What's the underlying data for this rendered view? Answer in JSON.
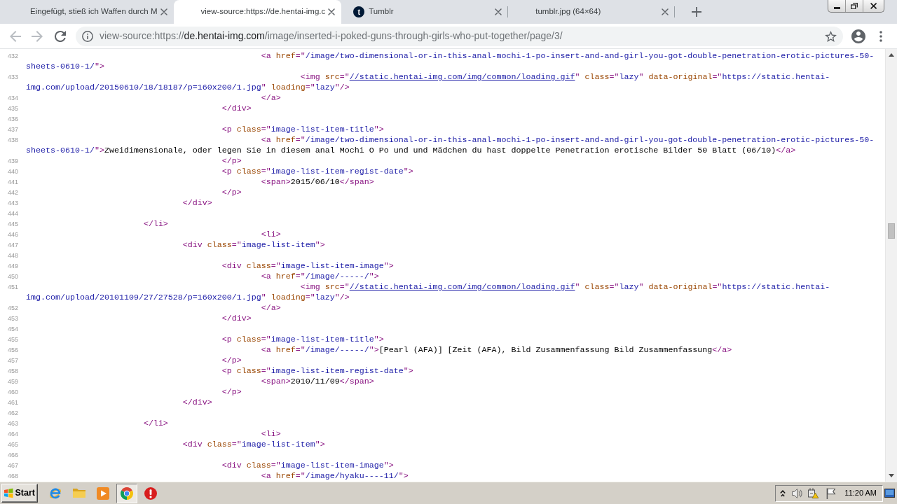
{
  "tabs": [
    {
      "title": "Eingefügt, stieß ich Waffen durch M",
      "selected": false
    },
    {
      "title": "view-source:https://de.hentai-img.c",
      "selected": true
    },
    {
      "title": "Tumblr",
      "selected": false,
      "favicon": "t"
    },
    {
      "title": "tumblr.jpg (64×64)",
      "selected": false
    }
  ],
  "toolbar": {
    "back": {
      "disabled": true
    },
    "forward": {
      "disabled": true
    },
    "address": [
      {
        "text": "view-source:https://",
        "emphasis": false
      },
      {
        "text": "de.hentai-img.com",
        "emphasis": true
      },
      {
        "text": "/image/inserted-i-poked-guns-through-girls-who-put-together/page/3/",
        "emphasis": false
      }
    ]
  },
  "source": {
    "lines": [
      {
        "number": "432",
        "tokens": [
          {
            "kind": "tag",
            "text": "\t\t\t\t\t\t<a "
          },
          {
            "kind": "attr",
            "text": "href"
          },
          {
            "kind": "tag",
            "text": "=\""
          },
          {
            "kind": "value",
            "text": "/image/two-dimensional-or-in-this-anal-mochi-1-po-insert-and-and-girl-you-got-double-penetration-erotic-pictures-50-sheets-0610-1/"
          },
          {
            "kind": "tag",
            "text": "\">"
          }
        ]
      },
      {
        "number": "433",
        "tokens": [
          {
            "kind": "tag",
            "text": "\t\t\t\t\t\t\t<img "
          },
          {
            "kind": "attr",
            "text": "src"
          },
          {
            "kind": "tag",
            "text": "=\""
          },
          {
            "kind": "link",
            "text": "//static.hentai-img.com/img/common/loading.gif"
          },
          {
            "kind": "tag",
            "text": "\" "
          },
          {
            "kind": "attr",
            "text": "class"
          },
          {
            "kind": "tag",
            "text": "=\""
          },
          {
            "kind": "value",
            "text": "lazy"
          },
          {
            "kind": "tag",
            "text": "\" "
          },
          {
            "kind": "attr",
            "text": "data-original"
          },
          {
            "kind": "tag",
            "text": "=\""
          },
          {
            "kind": "value",
            "text": "https://static.hentai-img.com/upload/20150610/18/18187/p=160x200/1.jpg"
          },
          {
            "kind": "tag",
            "text": "\" "
          },
          {
            "kind": "attr",
            "text": "loading"
          },
          {
            "kind": "tag",
            "text": "=\""
          },
          {
            "kind": "value",
            "text": "lazy"
          },
          {
            "kind": "tag",
            "text": "\"/>"
          }
        ]
      },
      {
        "number": "434",
        "tokens": [
          {
            "kind": "tag",
            "text": "\t\t\t\t\t\t</a>"
          }
        ]
      },
      {
        "number": "435",
        "tokens": [
          {
            "kind": "tag",
            "text": "\t\t\t\t\t</div>"
          }
        ]
      },
      {
        "number": "436"
      },
      {
        "number": "437",
        "tokens": [
          {
            "kind": "tag",
            "text": "\t\t\t\t\t<p "
          },
          {
            "kind": "attr",
            "text": "class"
          },
          {
            "kind": "tag",
            "text": "=\""
          },
          {
            "kind": "value",
            "text": "image-list-item-title"
          },
          {
            "kind": "tag",
            "text": "\">"
          }
        ]
      },
      {
        "number": "438",
        "tokens": [
          {
            "kind": "tag",
            "text": "\t\t\t\t\t\t<a "
          },
          {
            "kind": "attr",
            "text": "href"
          },
          {
            "kind": "tag",
            "text": "=\""
          },
          {
            "kind": "value",
            "text": "/image/two-dimensional-or-in-this-anal-mochi-1-po-insert-and-and-girl-you-got-double-penetration-erotic-pictures-50-sheets-0610-1/"
          },
          {
            "kind": "tag",
            "text": "\">"
          },
          {
            "kind": "text",
            "text": "Zweidimensionale, oder legen Sie in diesem anal Mochi O Po und und Mädchen du hast doppelte Penetration erotische Bilder 50 Blatt (06/10)"
          },
          {
            "kind": "tag",
            "text": "</a>"
          }
        ]
      },
      {
        "number": "439",
        "tokens": [
          {
            "kind": "tag",
            "text": "\t\t\t\t\t</p>"
          }
        ]
      },
      {
        "number": "440",
        "tokens": [
          {
            "kind": "tag",
            "text": "\t\t\t\t\t<p "
          },
          {
            "kind": "attr",
            "text": "class"
          },
          {
            "kind": "tag",
            "text": "=\""
          },
          {
            "kind": "value",
            "text": "image-list-item-regist-date"
          },
          {
            "kind": "tag",
            "text": "\">"
          }
        ]
      },
      {
        "number": "441",
        "tokens": [
          {
            "kind": "tag",
            "text": "\t\t\t\t\t\t<span>"
          },
          {
            "kind": "text",
            "text": "2015/06/10"
          },
          {
            "kind": "tag",
            "text": "</span>"
          }
        ]
      },
      {
        "number": "442",
        "tokens": [
          {
            "kind": "tag",
            "text": "\t\t\t\t\t</p>"
          }
        ]
      },
      {
        "number": "443",
        "tokens": [
          {
            "kind": "tag",
            "text": "\t\t\t\t</div>"
          }
        ]
      },
      {
        "number": "444"
      },
      {
        "number": "445",
        "tokens": [
          {
            "kind": "tag",
            "text": "\t\t\t</li>"
          }
        ]
      },
      {
        "number": "446",
        "tokens": [
          {
            "kind": "tag",
            "text": "\t\t\t\t\t\t<li>"
          }
        ]
      },
      {
        "number": "447",
        "tokens": [
          {
            "kind": "tag",
            "text": "\t\t\t\t<div "
          },
          {
            "kind": "attr",
            "text": "class"
          },
          {
            "kind": "tag",
            "text": "=\""
          },
          {
            "kind": "value",
            "text": "image-list-item"
          },
          {
            "kind": "tag",
            "text": "\">"
          }
        ]
      },
      {
        "number": "448"
      },
      {
        "number": "449",
        "tokens": [
          {
            "kind": "tag",
            "text": "\t\t\t\t\t<div "
          },
          {
            "kind": "attr",
            "text": "class"
          },
          {
            "kind": "tag",
            "text": "=\""
          },
          {
            "kind": "value",
            "text": "image-list-item-image"
          },
          {
            "kind": "tag",
            "text": "\">"
          }
        ]
      },
      {
        "number": "450",
        "tokens": [
          {
            "kind": "tag",
            "text": "\t\t\t\t\t\t<a "
          },
          {
            "kind": "attr",
            "text": "href"
          },
          {
            "kind": "tag",
            "text": "=\""
          },
          {
            "kind": "value",
            "text": "/image/-----/"
          },
          {
            "kind": "tag",
            "text": "\">"
          }
        ]
      },
      {
        "number": "451",
        "tokens": [
          {
            "kind": "tag",
            "text": "\t\t\t\t\t\t\t<img "
          },
          {
            "kind": "attr",
            "text": "src"
          },
          {
            "kind": "tag",
            "text": "=\""
          },
          {
            "kind": "link",
            "text": "//static.hentai-img.com/img/common/loading.gif"
          },
          {
            "kind": "tag",
            "text": "\" "
          },
          {
            "kind": "attr",
            "text": "class"
          },
          {
            "kind": "tag",
            "text": "=\""
          },
          {
            "kind": "value",
            "text": "lazy"
          },
          {
            "kind": "tag",
            "text": "\" "
          },
          {
            "kind": "attr",
            "text": "data-original"
          },
          {
            "kind": "tag",
            "text": "=\""
          },
          {
            "kind": "value",
            "text": "https://static.hentai-img.com/upload/20101109/27/27528/p=160x200/1.jpg"
          },
          {
            "kind": "tag",
            "text": "\" "
          },
          {
            "kind": "attr",
            "text": "loading"
          },
          {
            "kind": "tag",
            "text": "=\""
          },
          {
            "kind": "value",
            "text": "lazy"
          },
          {
            "kind": "tag",
            "text": "\"/>"
          }
        ]
      },
      {
        "number": "452",
        "tokens": [
          {
            "kind": "tag",
            "text": "\t\t\t\t\t\t</a>"
          }
        ]
      },
      {
        "number": "453",
        "tokens": [
          {
            "kind": "tag",
            "text": "\t\t\t\t\t</div>"
          }
        ]
      },
      {
        "number": "454"
      },
      {
        "number": "455",
        "tokens": [
          {
            "kind": "tag",
            "text": "\t\t\t\t\t<p "
          },
          {
            "kind": "attr",
            "text": "class"
          },
          {
            "kind": "tag",
            "text": "=\""
          },
          {
            "kind": "value",
            "text": "image-list-item-title"
          },
          {
            "kind": "tag",
            "text": "\">"
          }
        ]
      },
      {
        "number": "456",
        "tokens": [
          {
            "kind": "tag",
            "text": "\t\t\t\t\t\t<a "
          },
          {
            "kind": "attr",
            "text": "href"
          },
          {
            "kind": "tag",
            "text": "=\""
          },
          {
            "kind": "value",
            "text": "/image/-----/"
          },
          {
            "kind": "tag",
            "text": "\">"
          },
          {
            "kind": "text",
            "text": "[Pearl (AFA)] [Zeit (AFA), Bild Zusammenfassung Bild Zusammenfassung"
          },
          {
            "kind": "tag",
            "text": "</a>"
          }
        ]
      },
      {
        "number": "457",
        "tokens": [
          {
            "kind": "tag",
            "text": "\t\t\t\t\t</p>"
          }
        ]
      },
      {
        "number": "458",
        "tokens": [
          {
            "kind": "tag",
            "text": "\t\t\t\t\t<p "
          },
          {
            "kind": "attr",
            "text": "class"
          },
          {
            "kind": "tag",
            "text": "=\""
          },
          {
            "kind": "value",
            "text": "image-list-item-regist-date"
          },
          {
            "kind": "tag",
            "text": "\">"
          }
        ]
      },
      {
        "number": "459",
        "tokens": [
          {
            "kind": "tag",
            "text": "\t\t\t\t\t\t<span>"
          },
          {
            "kind": "text",
            "text": "2010/11/09"
          },
          {
            "kind": "tag",
            "text": "</span>"
          }
        ]
      },
      {
        "number": "460",
        "tokens": [
          {
            "kind": "tag",
            "text": "\t\t\t\t\t</p>"
          }
        ]
      },
      {
        "number": "461",
        "tokens": [
          {
            "kind": "tag",
            "text": "\t\t\t\t</div>"
          }
        ]
      },
      {
        "number": "462"
      },
      {
        "number": "463",
        "tokens": [
          {
            "kind": "tag",
            "text": "\t\t\t</li>"
          }
        ]
      },
      {
        "number": "464",
        "tokens": [
          {
            "kind": "tag",
            "text": "\t\t\t\t\t\t<li>"
          }
        ]
      },
      {
        "number": "465",
        "tokens": [
          {
            "kind": "tag",
            "text": "\t\t\t\t<div "
          },
          {
            "kind": "attr",
            "text": "class"
          },
          {
            "kind": "tag",
            "text": "=\""
          },
          {
            "kind": "value",
            "text": "image-list-item"
          },
          {
            "kind": "tag",
            "text": "\">"
          }
        ]
      },
      {
        "number": "466"
      },
      {
        "number": "467",
        "tokens": [
          {
            "kind": "tag",
            "text": "\t\t\t\t\t<div "
          },
          {
            "kind": "attr",
            "text": "class"
          },
          {
            "kind": "tag",
            "text": "=\""
          },
          {
            "kind": "value",
            "text": "image-list-item-image"
          },
          {
            "kind": "tag",
            "text": "\">"
          }
        ]
      },
      {
        "number": "468",
        "tokens": [
          {
            "kind": "tag",
            "text": "\t\t\t\t\t\t<a "
          },
          {
            "kind": "attr",
            "text": "href"
          },
          {
            "kind": "tag",
            "text": "=\""
          },
          {
            "kind": "value",
            "text": "/image/hyaku----11/"
          },
          {
            "kind": "tag",
            "text": "\">"
          }
        ]
      }
    ]
  },
  "taskbar": {
    "start": "Start",
    "buttons": [
      {
        "selected": false
      },
      {
        "selected": false
      },
      {
        "selected": false
      },
      {
        "selected": true
      },
      {
        "selected": false
      }
    ],
    "clock": "11:20 AM"
  }
}
